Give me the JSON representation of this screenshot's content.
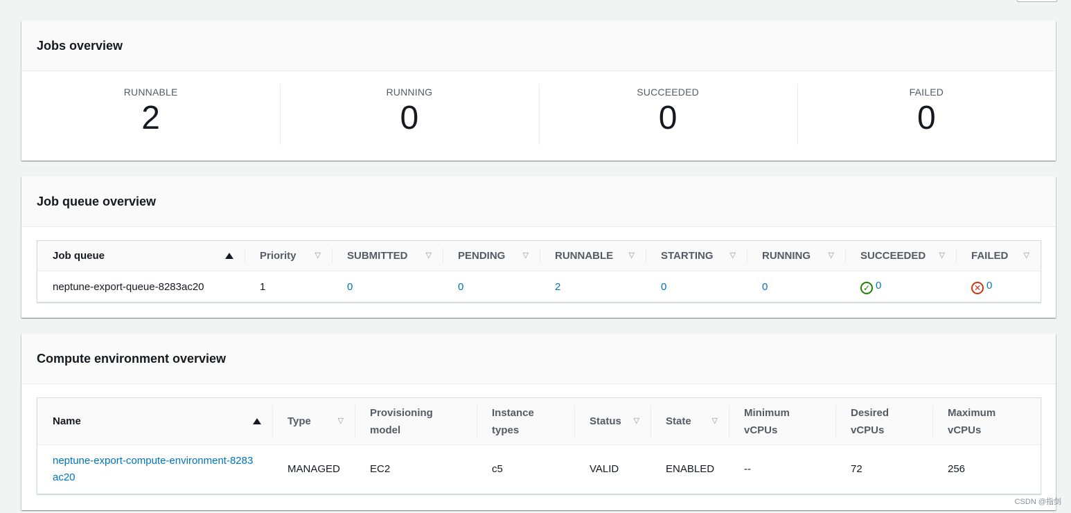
{
  "jobs_overview": {
    "title": "Jobs overview",
    "stats": [
      {
        "label": "RUNNABLE",
        "value": "2"
      },
      {
        "label": "RUNNING",
        "value": "0"
      },
      {
        "label": "SUCCEEDED",
        "value": "0"
      },
      {
        "label": "FAILED",
        "value": "0"
      }
    ]
  },
  "job_queue_overview": {
    "title": "Job queue overview",
    "columns": [
      "Job queue",
      "Priority",
      "SUBMITTED",
      "PENDING",
      "RUNNABLE",
      "STARTING",
      "RUNNING",
      "SUCCEEDED",
      "FAILED"
    ],
    "rows": [
      {
        "job_queue": "neptune-export-queue-8283ac20",
        "priority": "1",
        "submitted": "0",
        "pending": "0",
        "runnable": "2",
        "starting": "0",
        "running": "0",
        "succeeded": "0",
        "failed": "0"
      }
    ]
  },
  "compute_environment_overview": {
    "title": "Compute environment overview",
    "columns": {
      "name": "Name",
      "type": "Type",
      "provisioning_model": "Provisioning model",
      "instance_types": "Instance types",
      "status": "Status",
      "state": "State",
      "minimum_vcpus": "Minimum vCPUs",
      "desired_vcpus": "Desired vCPUs",
      "maximum_vcpus": "Maximum vCPUs"
    },
    "rows": [
      {
        "name": "neptune-export-compute-environment-8283ac20",
        "type": "MANAGED",
        "provisioning_model": "EC2",
        "instance_types": "c5",
        "status": "VALID",
        "state": "ENABLED",
        "minimum_vcpus": "--",
        "desired_vcpus": "72",
        "maximum_vcpus": "256"
      }
    ]
  },
  "watermark": "CSDN @指剑",
  "icons": {
    "sort_ascending": "sort-ascending-icon",
    "sort_descending": "sort-descending-icon",
    "success": "check-circle-icon",
    "error": "x-circle-icon"
  },
  "colors": {
    "link": "#0073bb",
    "success": "#1d8102",
    "error": "#d13212"
  }
}
